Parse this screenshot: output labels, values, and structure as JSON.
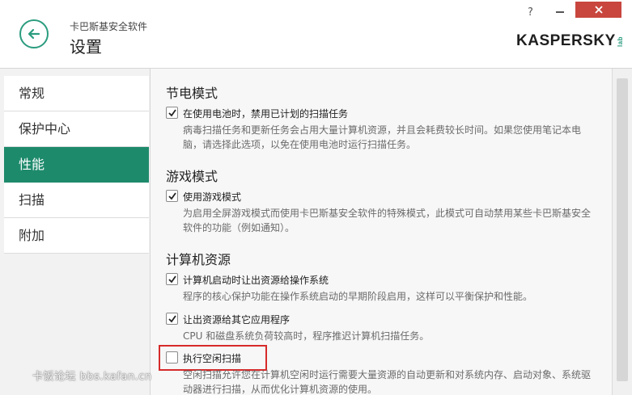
{
  "header": {
    "app_name": "卡巴斯基安全软件",
    "page_title": "设置",
    "help": "?",
    "logo_text": "KASPERSKY",
    "logo_suffix": "lab"
  },
  "sidebar": {
    "items": [
      {
        "label": "常规",
        "active": false
      },
      {
        "label": "保护中心",
        "active": false
      },
      {
        "label": "性能",
        "active": true
      },
      {
        "label": "扫描",
        "active": false
      },
      {
        "label": "附加",
        "active": false
      }
    ]
  },
  "content": {
    "sections": [
      {
        "title": "节电模式",
        "options": [
          {
            "label": "在使用电池时，禁用已计划的扫描任务",
            "checked": true,
            "description": "病毒扫描任务和更新任务会占用大量计算机资源，并且会耗费较长时间。如果您使用笔记本电脑，请选择此选项，以免在使用电池时运行扫描任务。"
          }
        ]
      },
      {
        "title": "游戏模式",
        "options": [
          {
            "label": "使用游戏模式",
            "checked": true,
            "description": "为启用全屏游戏模式而使用卡巴斯基安全软件的特殊模式，此模式可自动禁用某些卡巴斯基安全软件的功能（例如通知）。"
          }
        ]
      },
      {
        "title": "计算机资源",
        "options": [
          {
            "label": "计算机启动时让出资源给操作系统",
            "checked": true,
            "description": "程序的核心保护功能在操作系统启动的早期阶段启用，这样可以平衡保护和性能。"
          },
          {
            "label": "让出资源给其它应用程序",
            "checked": true,
            "description": "CPU 和磁盘系统负荷较高时，程序推迟计算机扫描任务。"
          },
          {
            "label": "执行空闲扫描",
            "checked": false,
            "description": "空闲扫描允许您在计算机空闲时运行需要大量资源的自动更新和对系统内存、启动对象、系统驱动器进行扫描，从而优化计算机资源的使用。"
          }
        ]
      }
    ]
  },
  "watermark": "卡饭论坛 bbs.kafan.cn",
  "colors": {
    "accent": "#1e8a6c",
    "close": "#c8463e",
    "highlight": "#d62a2a"
  },
  "icons": {
    "back": "arrow-left-icon",
    "close": "close-icon",
    "minimize": "minimize-icon",
    "help": "help-icon",
    "check": "checkmark-icon"
  }
}
